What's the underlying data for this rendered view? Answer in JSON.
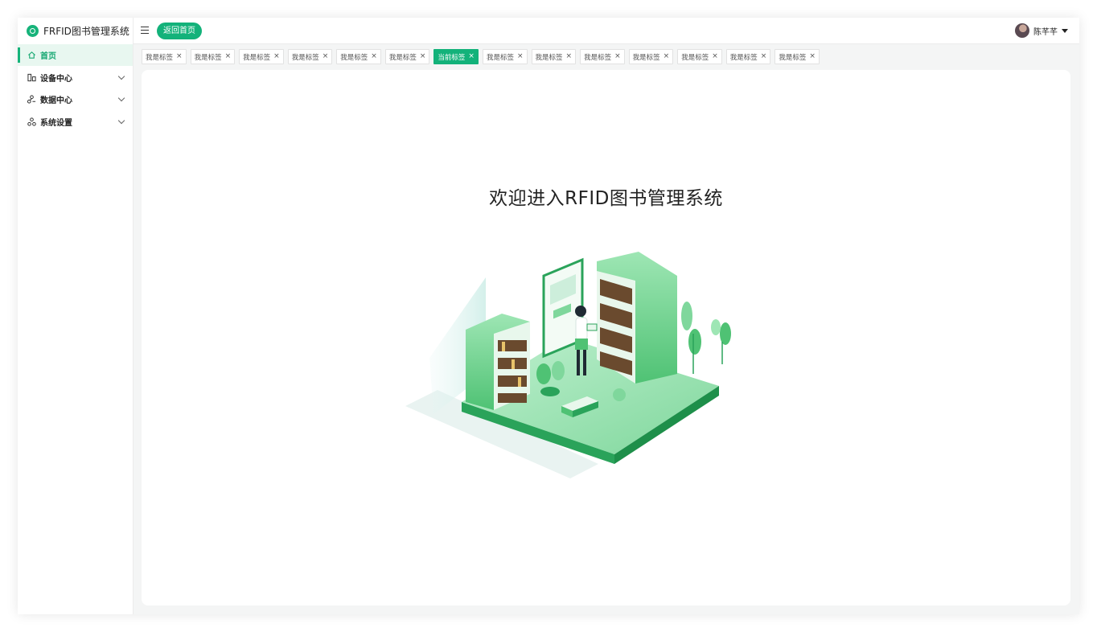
{
  "app": {
    "title": "FRFID图书管理系统"
  },
  "sidebar": {
    "items": [
      {
        "label": "首页",
        "icon": "home-icon",
        "active": true
      },
      {
        "label": "设备中心",
        "icon": "device-icon",
        "expandable": true
      },
      {
        "label": "数据中心",
        "icon": "data-icon",
        "expandable": true
      },
      {
        "label": "系统设置",
        "icon": "settings-icon",
        "expandable": true
      }
    ]
  },
  "header": {
    "back_home_label": "返回首页",
    "user_name": "陈芊芊"
  },
  "tabs": [
    {
      "label": "我是标签",
      "active": false
    },
    {
      "label": "我是标签",
      "active": false
    },
    {
      "label": "我是标签",
      "active": false
    },
    {
      "label": "我是标签",
      "active": false
    },
    {
      "label": "我是标签",
      "active": false
    },
    {
      "label": "我是标签",
      "active": false
    },
    {
      "label": "当前标签",
      "active": true
    },
    {
      "label": "我是标签",
      "active": false
    },
    {
      "label": "我是标签",
      "active": false
    },
    {
      "label": "我是标签",
      "active": false
    },
    {
      "label": "我是标签",
      "active": false
    },
    {
      "label": "我是标签",
      "active": false
    },
    {
      "label": "我是标签",
      "active": false
    },
    {
      "label": "我是标签",
      "active": false
    }
  ],
  "main": {
    "welcome_text": "欢迎进入RFID图书管理系统"
  },
  "colors": {
    "accent": "#13b27a",
    "accent_light": "#e8f7f0"
  }
}
